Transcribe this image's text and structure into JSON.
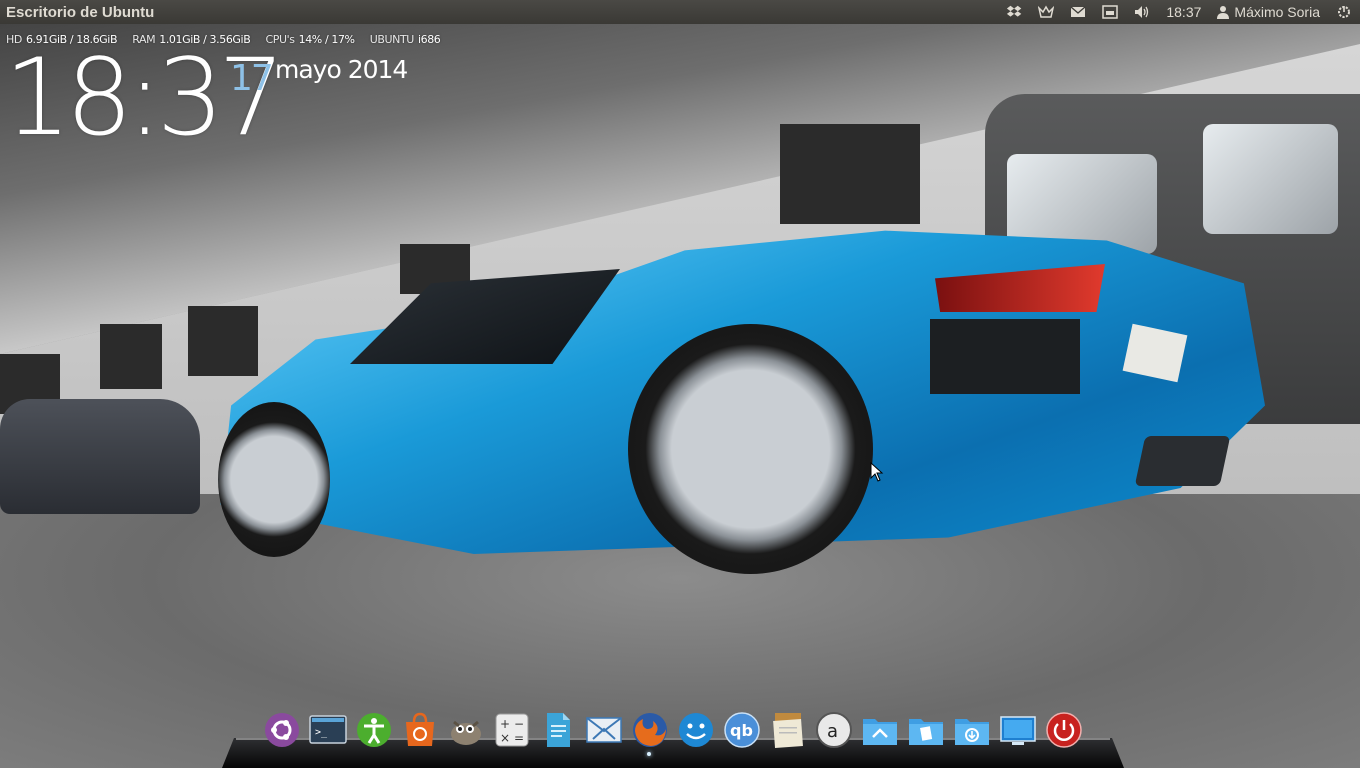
{
  "panel": {
    "title": "Escritorio de Ubuntu",
    "clock": "18:37",
    "user": "Máximo Soria",
    "indicators": [
      "dropbox-icon",
      "messaging-icon",
      "mail-icon",
      "keyboard-icon",
      "volume-icon"
    ]
  },
  "conky": {
    "hd_label": "HD",
    "hd_value": "6.91GiB / 18.6GiB",
    "ram_label": "RAM",
    "ram_value": "1.01GiB / 3.56GiB",
    "cpu_label": "CPU's",
    "cpu_value": "14% / 17%",
    "os_label": "UBUNTU",
    "os_value": "i686",
    "time": "18:37",
    "day": "17",
    "month_year": "mayo 2014"
  },
  "dock": {
    "items": [
      {
        "name": "ubuntu-logo-icon",
        "running": false
      },
      {
        "name": "terminal-icon",
        "running": false
      },
      {
        "name": "accessibility-icon",
        "running": false
      },
      {
        "name": "software-center-icon",
        "running": false
      },
      {
        "name": "gimp-icon",
        "running": false
      },
      {
        "name": "calculator-icon",
        "running": false
      },
      {
        "name": "document-icon",
        "running": false
      },
      {
        "name": "mail-eagle-icon",
        "running": false
      },
      {
        "name": "firefox-icon",
        "running": true
      },
      {
        "name": "pidgin-icon",
        "running": false
      },
      {
        "name": "qbittorrent-icon",
        "running": false
      },
      {
        "name": "notes-icon",
        "running": false
      },
      {
        "name": "amazon-icon",
        "running": false
      },
      {
        "name": "home-folder-icon",
        "running": false
      },
      {
        "name": "documents-folder-icon",
        "running": false
      },
      {
        "name": "downloads-folder-icon",
        "running": false
      },
      {
        "name": "monitor-icon",
        "running": false
      },
      {
        "name": "power-icon",
        "running": false
      }
    ]
  },
  "colors": {
    "panel_bg": "#3c3b37",
    "panel_text": "#dfdbd2",
    "conky_day": "#8ec1e7",
    "dock_indicator": "#d8f0ff"
  }
}
